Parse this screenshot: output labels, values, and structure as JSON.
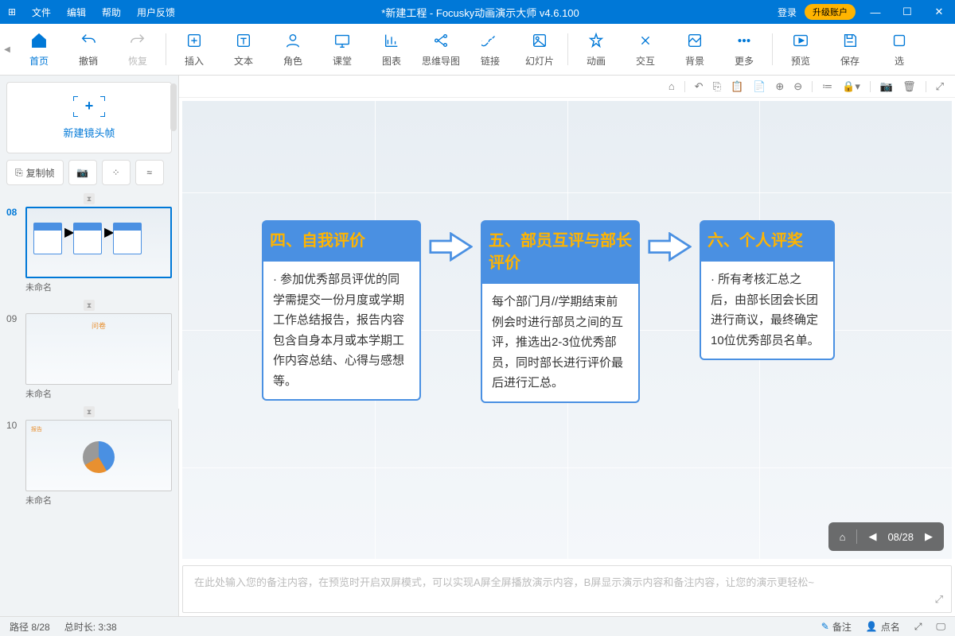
{
  "titlebar": {
    "menu": [
      "文件",
      "编辑",
      "帮助",
      "用户反馈"
    ],
    "title": "*新建工程 - Focusky动画演示大师  v4.6.100",
    "login": "登录",
    "upgrade": "升级账户"
  },
  "ribbon": {
    "home": "首页",
    "undo": "撤销",
    "redo": "恢复",
    "insert": "插入",
    "text": "文本",
    "role": "角色",
    "class": "课堂",
    "chart": "图表",
    "mindmap": "思维导图",
    "link": "链接",
    "slide": "幻灯片",
    "anim": "动画",
    "interact": "交互",
    "bg": "背景",
    "more": "更多",
    "preview": "预览",
    "save": "保存",
    "select": "选"
  },
  "sidebar": {
    "newframe": "新建镜头帧",
    "copyframe": "复制帧",
    "thumbs": [
      {
        "num": "08",
        "label": "未命名",
        "active": true
      },
      {
        "num": "09",
        "label": "未命名",
        "active": false
      },
      {
        "num": "10",
        "label": "未命名",
        "active": false
      }
    ]
  },
  "slide": {
    "box1_title": "四、自我评价",
    "box1_body": "参加优秀部员评优的同学需提交一份月度或学期工作总结报告，报告内容包含自身本月或本学期工作内容总结、心得与感想等。",
    "box2_title": "五、部员互评与部长评价",
    "box2_body": "每个部门月//学期结束前例会时进行部员之间的互评，推选出2-3位优秀部员，同时部长进行评价最后进行汇总。",
    "box3_title": "六、个人评奖",
    "box3_body": "所有考核汇总之后，由部长团会长团进行商议，最终确定10位优秀部员名单。"
  },
  "nav_overlay": {
    "page": "08/28"
  },
  "notes": {
    "placeholder": "在此处输入您的备注内容，在预览时开启双屏模式，可以实现A屏全屏播放演示内容，B屏显示演示内容和备注内容，让您的演示更轻松~"
  },
  "status": {
    "path": "路径 8/28",
    "duration": "总时长: 3:38",
    "notes": "备注",
    "like": "点名"
  }
}
